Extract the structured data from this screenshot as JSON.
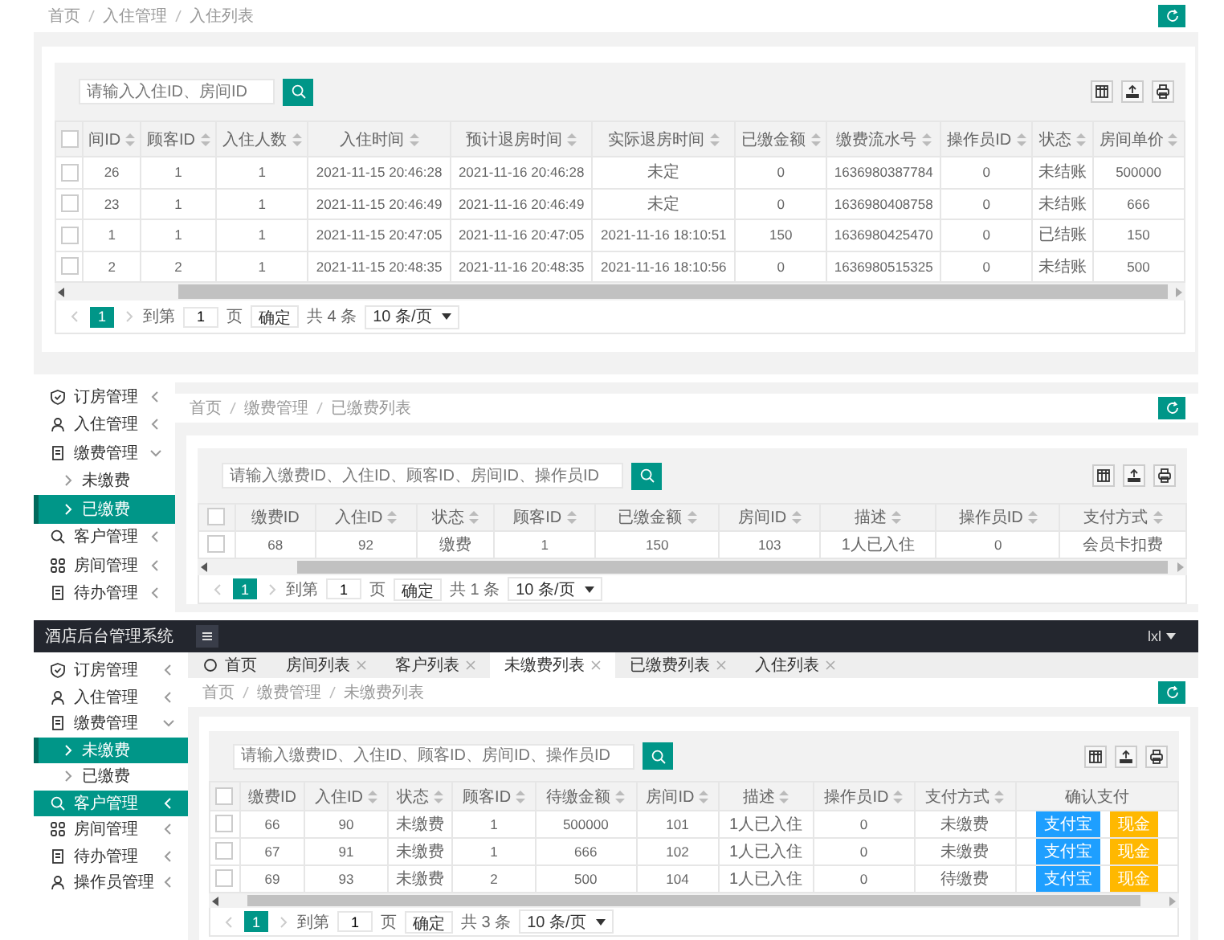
{
  "panels": [
    {
      "kind": "plain",
      "breadcrumb": [
        "首页",
        "入住管理",
        "入住列表"
      ],
      "search": {
        "placeholder": "请输入入住ID、房间ID"
      },
      "table": {
        "all_checked": false,
        "columns": [
          {
            "label": "间ID",
            "sortable": true
          },
          {
            "label": "顾客ID",
            "sortable": true
          },
          {
            "label": "入住人数",
            "sortable": true
          },
          {
            "label": "入住时间",
            "sortable": true
          },
          {
            "label": "预计退房时间",
            "sortable": true
          },
          {
            "label": "实际退房时间",
            "sortable": true
          },
          {
            "label": "已缴金额",
            "sortable": true
          },
          {
            "label": "缴费流水号",
            "sortable": true
          },
          {
            "label": "操作员ID",
            "sortable": true
          },
          {
            "label": "状态",
            "sortable": true
          },
          {
            "label": "房间单价",
            "sortable": true
          }
        ],
        "rows": [
          {
            "checked": false,
            "cells": [
              "26",
              "1",
              "1",
              "2021-11-15 20:46:28",
              "2021-11-16 20:46:28",
              "未定",
              "0",
              "1636980387784",
              "0",
              "未结账",
              "500000"
            ]
          },
          {
            "checked": false,
            "cells": [
              "23",
              "1",
              "1",
              "2021-11-15 20:46:49",
              "2021-11-16 20:46:49",
              "未定",
              "0",
              "1636980408758",
              "0",
              "未结账",
              "666"
            ]
          },
          {
            "checked": false,
            "cells": [
              "1",
              "1",
              "1",
              "2021-11-15 20:47:05",
              "2021-11-16 20:47:05",
              "2021-11-16 18:10:51",
              "150",
              "1636980425470",
              "0",
              "已结账",
              "150"
            ]
          },
          {
            "checked": false,
            "cells": [
              "2",
              "2",
              "1",
              "2021-11-15 20:48:35",
              "2021-11-16 20:48:35",
              "2021-11-16 18:10:56",
              "0",
              "1636980515325",
              "0",
              "未结账",
              "500"
            ]
          }
        ]
      },
      "pager": {
        "pages": [
          {
            "label": "1",
            "selected": true
          }
        ],
        "goto_label": "到第",
        "goto_value": "1",
        "page_unit": "页",
        "confirm": "确定",
        "total": "共 4 条",
        "page_size": "10 条/页"
      }
    },
    {
      "kind": "sidebar",
      "sidebar": {
        "items": [
          {
            "label": "订房管理",
            "expanded": false,
            "selected": false,
            "hovered": false
          },
          {
            "label": "入住管理",
            "expanded": false,
            "selected": false,
            "hovered": false
          },
          {
            "label": "缴费管理",
            "expanded": true,
            "selected": false,
            "hovered": false,
            "children": [
              {
                "label": "未缴费",
                "selected": false,
                "hovered": false
              },
              {
                "label": "已缴费",
                "selected": true,
                "hovered": false
              }
            ]
          },
          {
            "label": "客户管理",
            "expanded": false,
            "selected": false,
            "hovered": false
          },
          {
            "label": "房间管理",
            "expanded": false,
            "selected": false,
            "hovered": false
          },
          {
            "label": "待办管理",
            "expanded": false,
            "selected": false,
            "hovered": false
          }
        ]
      },
      "breadcrumb": [
        "首页",
        "缴费管理",
        "已缴费列表"
      ],
      "search": {
        "placeholder": "请输入缴费ID、入住ID、顾客ID、房间ID、操作员ID"
      },
      "table": {
        "all_checked": false,
        "columns": [
          {
            "label": "缴费ID",
            "sortable": false
          },
          {
            "label": "入住ID",
            "sortable": true
          },
          {
            "label": "状态",
            "sortable": true
          },
          {
            "label": "顾客ID",
            "sortable": true
          },
          {
            "label": "已缴金额",
            "sortable": true
          },
          {
            "label": "房间ID",
            "sortable": true
          },
          {
            "label": "描述",
            "sortable": true
          },
          {
            "label": "操作员ID",
            "sortable": true
          },
          {
            "label": "支付方式",
            "sortable": true
          }
        ],
        "rows": [
          {
            "checked": false,
            "cells": [
              "68",
              "92",
              "缴费",
              "1",
              "150",
              "103",
              "1人已入住",
              "0",
              "会员卡扣费"
            ]
          }
        ]
      },
      "pager": {
        "pages": [
          {
            "label": "1",
            "selected": true
          }
        ],
        "goto_label": "到第",
        "goto_value": "1",
        "page_unit": "页",
        "confirm": "确定",
        "total": "共 1 条",
        "page_size": "10 条/页"
      }
    },
    {
      "kind": "full",
      "header": {
        "title": "酒店后台管理系统",
        "user": "lxl"
      },
      "sidebar": {
        "items": [
          {
            "label": "订房管理",
            "expanded": false,
            "selected": false,
            "hovered": false
          },
          {
            "label": "入住管理",
            "expanded": false,
            "selected": false,
            "hovered": false
          },
          {
            "label": "缴费管理",
            "expanded": true,
            "selected": false,
            "hovered": false,
            "children": [
              {
                "label": "未缴费",
                "selected": true,
                "hovered": false
              },
              {
                "label": "已缴费",
                "selected": false,
                "hovered": false
              }
            ]
          },
          {
            "label": "客户管理",
            "expanded": false,
            "selected": false,
            "hovered": true
          },
          {
            "label": "房间管理",
            "expanded": false,
            "selected": false,
            "hovered": false
          },
          {
            "label": "待办管理",
            "expanded": false,
            "selected": false,
            "hovered": false
          },
          {
            "label": "操作员管理",
            "expanded": false,
            "selected": false,
            "hovered": false
          }
        ]
      },
      "tabs": [
        {
          "label": "首页",
          "kind": "home",
          "selected": false
        },
        {
          "label": "房间列表",
          "kind": "page",
          "selected": false
        },
        {
          "label": "客户列表",
          "kind": "page",
          "selected": false
        },
        {
          "label": "未缴费列表",
          "kind": "page",
          "selected": true
        },
        {
          "label": "已缴费列表",
          "kind": "page",
          "selected": false
        },
        {
          "label": "入住列表",
          "kind": "page",
          "selected": false
        }
      ],
      "breadcrumb": [
        "首页",
        "缴费管理",
        "未缴费列表"
      ],
      "search": {
        "placeholder": "请输入缴费ID、入住ID、顾客ID、房间ID、操作员ID"
      },
      "table": {
        "all_checked": false,
        "columns": [
          {
            "label": "缴费ID",
            "sortable": false
          },
          {
            "label": "入住ID",
            "sortable": true
          },
          {
            "label": "状态",
            "sortable": true
          },
          {
            "label": "顾客ID",
            "sortable": true
          },
          {
            "label": "待缴金额",
            "sortable": true
          },
          {
            "label": "房间ID",
            "sortable": true
          },
          {
            "label": "描述",
            "sortable": true
          },
          {
            "label": "操作员ID",
            "sortable": true
          },
          {
            "label": "支付方式",
            "sortable": true
          },
          {
            "label": "确认支付",
            "sortable": false
          }
        ],
        "rows": [
          {
            "checked": false,
            "cells": [
              "66",
              "90",
              "未缴费",
              "1",
              "500000",
              "101",
              "1人已入住",
              "0",
              "未缴费"
            ],
            "actions": [
              {
                "label": "支付宝",
                "kind": "online"
              },
              {
                "label": "现金",
                "kind": "cash"
              }
            ]
          },
          {
            "checked": false,
            "cells": [
              "67",
              "91",
              "未缴费",
              "1",
              "666",
              "102",
              "1人已入住",
              "0",
              "未缴费"
            ],
            "actions": [
              {
                "label": "支付宝",
                "kind": "online"
              },
              {
                "label": "现金",
                "kind": "cash"
              }
            ]
          },
          {
            "checked": false,
            "cells": [
              "69",
              "93",
              "未缴费",
              "2",
              "500",
              "104",
              "1人已入住",
              "0",
              "待缴费"
            ],
            "actions": [
              {
                "label": "支付宝",
                "kind": "online"
              },
              {
                "label": "现金",
                "kind": "cash"
              }
            ]
          }
        ]
      },
      "pager": {
        "pages": [
          {
            "label": "1",
            "selected": true
          }
        ],
        "goto_label": "到第",
        "goto_value": "1",
        "page_unit": "页",
        "confirm": "确定",
        "total": "共 3 条",
        "page_size": "10 条/页"
      }
    }
  ]
}
